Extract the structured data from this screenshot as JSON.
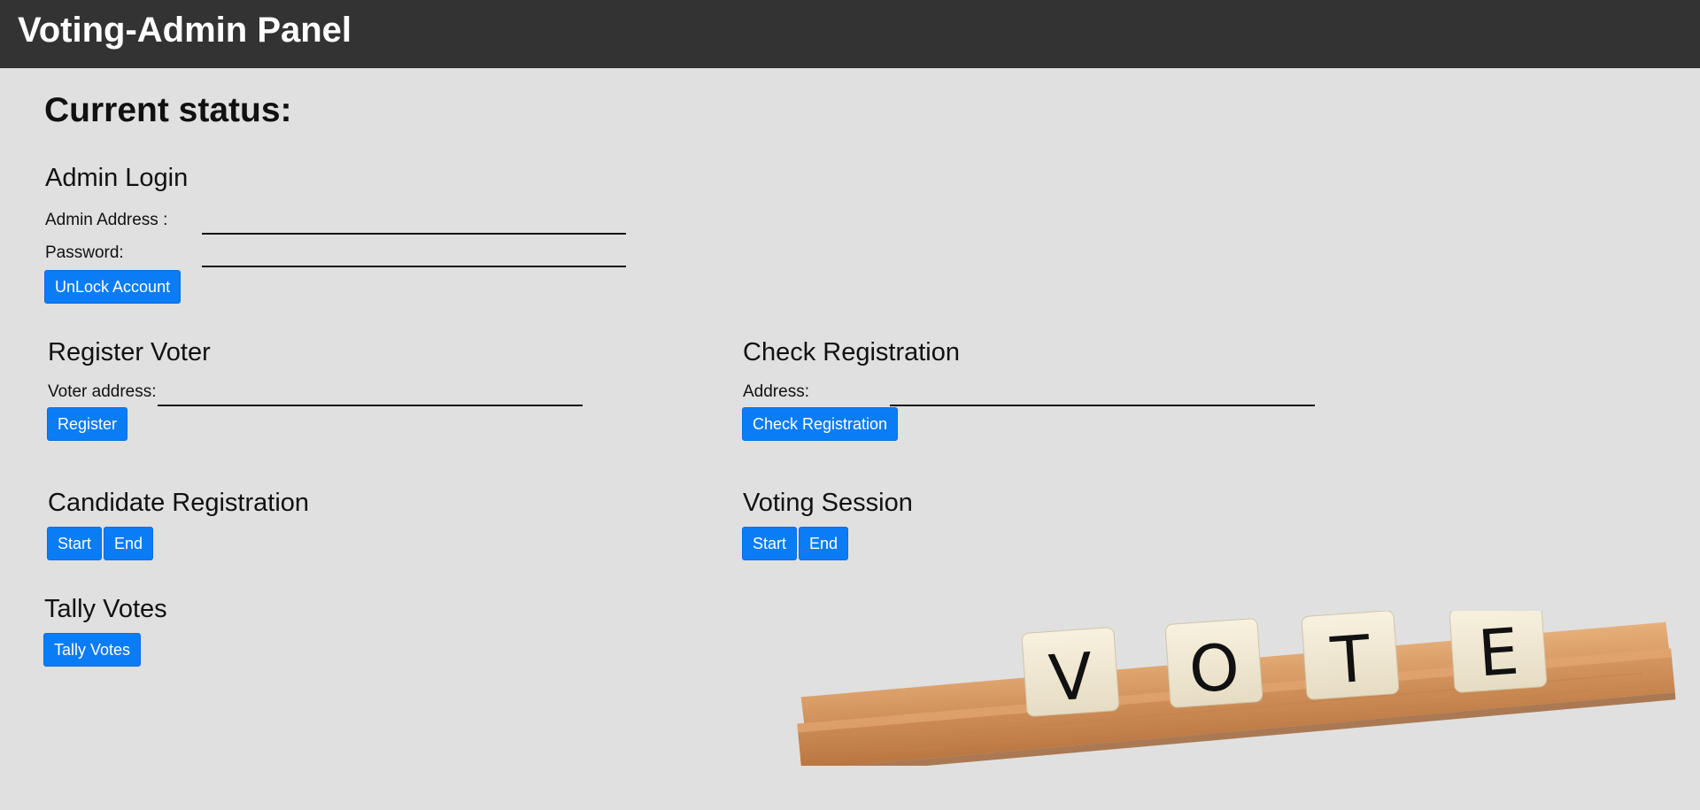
{
  "header": {
    "title": "Voting-Admin Panel"
  },
  "status": {
    "heading": "Current status:"
  },
  "admin_login": {
    "title": "Admin Login",
    "address_label": "Admin Address :",
    "address_value": "",
    "password_label": "Password:",
    "password_value": "",
    "unlock_button": "UnLock Account"
  },
  "register_voter": {
    "title": "Register Voter",
    "address_label": "Voter address:",
    "address_value": "",
    "register_button": "Register"
  },
  "check_registration": {
    "title": "Check Registration",
    "address_label": "Address:",
    "address_value": "",
    "check_button": "Check Registration"
  },
  "candidate_registration": {
    "title": "Candidate Registration",
    "start_button": "Start",
    "end_button": "End"
  },
  "voting_session": {
    "title": "Voting Session",
    "start_button": "Start",
    "end_button": "End"
  },
  "tally": {
    "title": "Tally Votes",
    "tally_button": "Tally Votes"
  },
  "vote_image": {
    "tiles": [
      "V",
      "O",
      "T",
      "E"
    ],
    "icon": "vote-scrabble-image"
  },
  "colors": {
    "header_bg": "#333333",
    "page_bg": "#e0e0e0",
    "button_bg": "#0a7cf5",
    "button_text": "#ffffff"
  }
}
